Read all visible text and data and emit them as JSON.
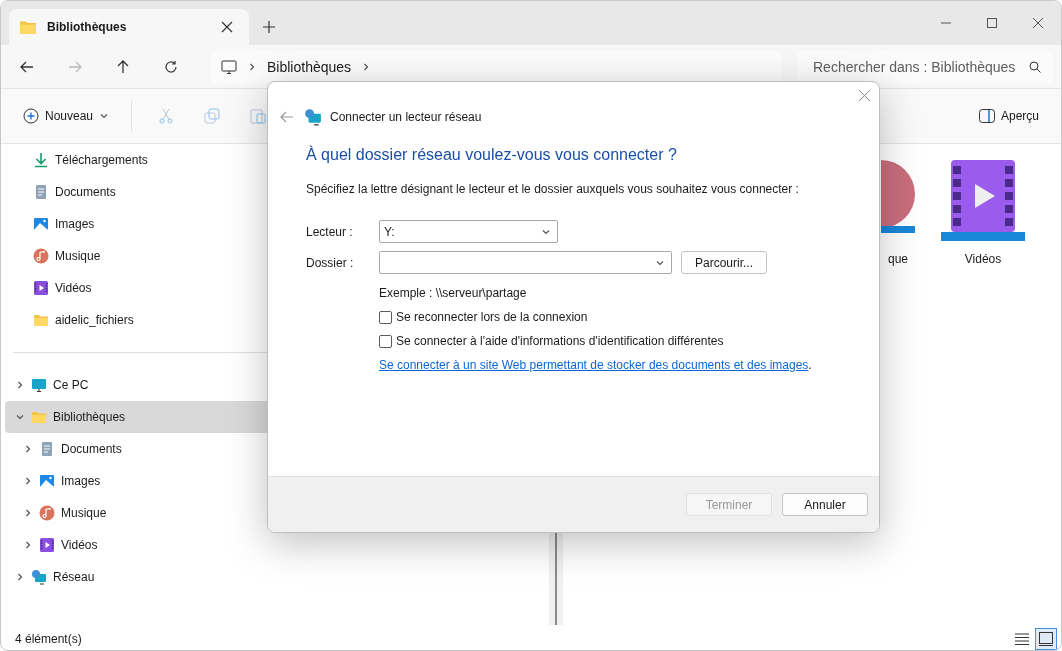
{
  "tab": {
    "title": "Bibliothèques"
  },
  "nav": {
    "address": [
      "Bibliothèques"
    ],
    "search": {
      "placeholder": "Rechercher dans : Bibliothèques"
    }
  },
  "command_bar": {
    "new_label": "Nouveau",
    "preview_label": "Aperçu"
  },
  "quick_access": [
    {
      "label": "Téléchargements",
      "kind": "downloads"
    },
    {
      "label": "Documents",
      "kind": "documents"
    },
    {
      "label": "Images",
      "kind": "images"
    },
    {
      "label": "Musique",
      "kind": "music"
    },
    {
      "label": "Vidéos",
      "kind": "videos"
    },
    {
      "label": "aidelic_fichiers",
      "kind": "folder"
    }
  ],
  "tree": [
    {
      "label": "Ce PC",
      "kind": "pc",
      "expanded": false,
      "selected": false
    },
    {
      "label": "Bibliothèques",
      "kind": "folder",
      "expanded": true,
      "selected": true,
      "children": [
        {
          "label": "Documents",
          "kind": "documents",
          "expanded": false,
          "selected": false
        },
        {
          "label": "Images",
          "kind": "images",
          "expanded": false,
          "selected": false
        },
        {
          "label": "Musique",
          "kind": "music",
          "expanded": false,
          "selected": false
        },
        {
          "label": "Vidéos",
          "kind": "videos",
          "expanded": false,
          "selected": false
        }
      ]
    },
    {
      "label": "Réseau",
      "kind": "network",
      "expanded": false,
      "selected": false
    }
  ],
  "content_items": [
    {
      "label": "que",
      "kind": "music"
    },
    {
      "label": "Vidéos",
      "kind": "videos"
    }
  ],
  "status_bar": {
    "count": "4 élément(s)",
    "views": [
      {
        "kind": "details",
        "selected": false
      },
      {
        "kind": "tiles",
        "selected": true
      }
    ]
  },
  "dialog": {
    "title": "Connecter un lecteur réseau",
    "heading": "À quel dossier réseau voulez-vous vous connecter ?",
    "instruction": "Spécifiez la lettre désignant le lecteur et le dossier auxquels vous souhaitez vous connecter :",
    "drive": {
      "label": "Lecteur :",
      "value": "Y:"
    },
    "folder": {
      "label": "Dossier :"
    },
    "browse": "Parcourir...",
    "example": "Exemple : \\\\serveur\\partage",
    "options": [
      {
        "label": "Se reconnecter lors de la connexion",
        "checked": false
      },
      {
        "label": "Se connecter à l'aide d'informations d'identification différentes",
        "checked": false
      }
    ],
    "link": "Se connecter à un site Web permettant de stocker des documents et des images",
    "link_suffix": ".",
    "buttons": [
      {
        "label": "Terminer",
        "disabled": true
      },
      {
        "label": "Annuler",
        "disabled": false
      }
    ]
  }
}
